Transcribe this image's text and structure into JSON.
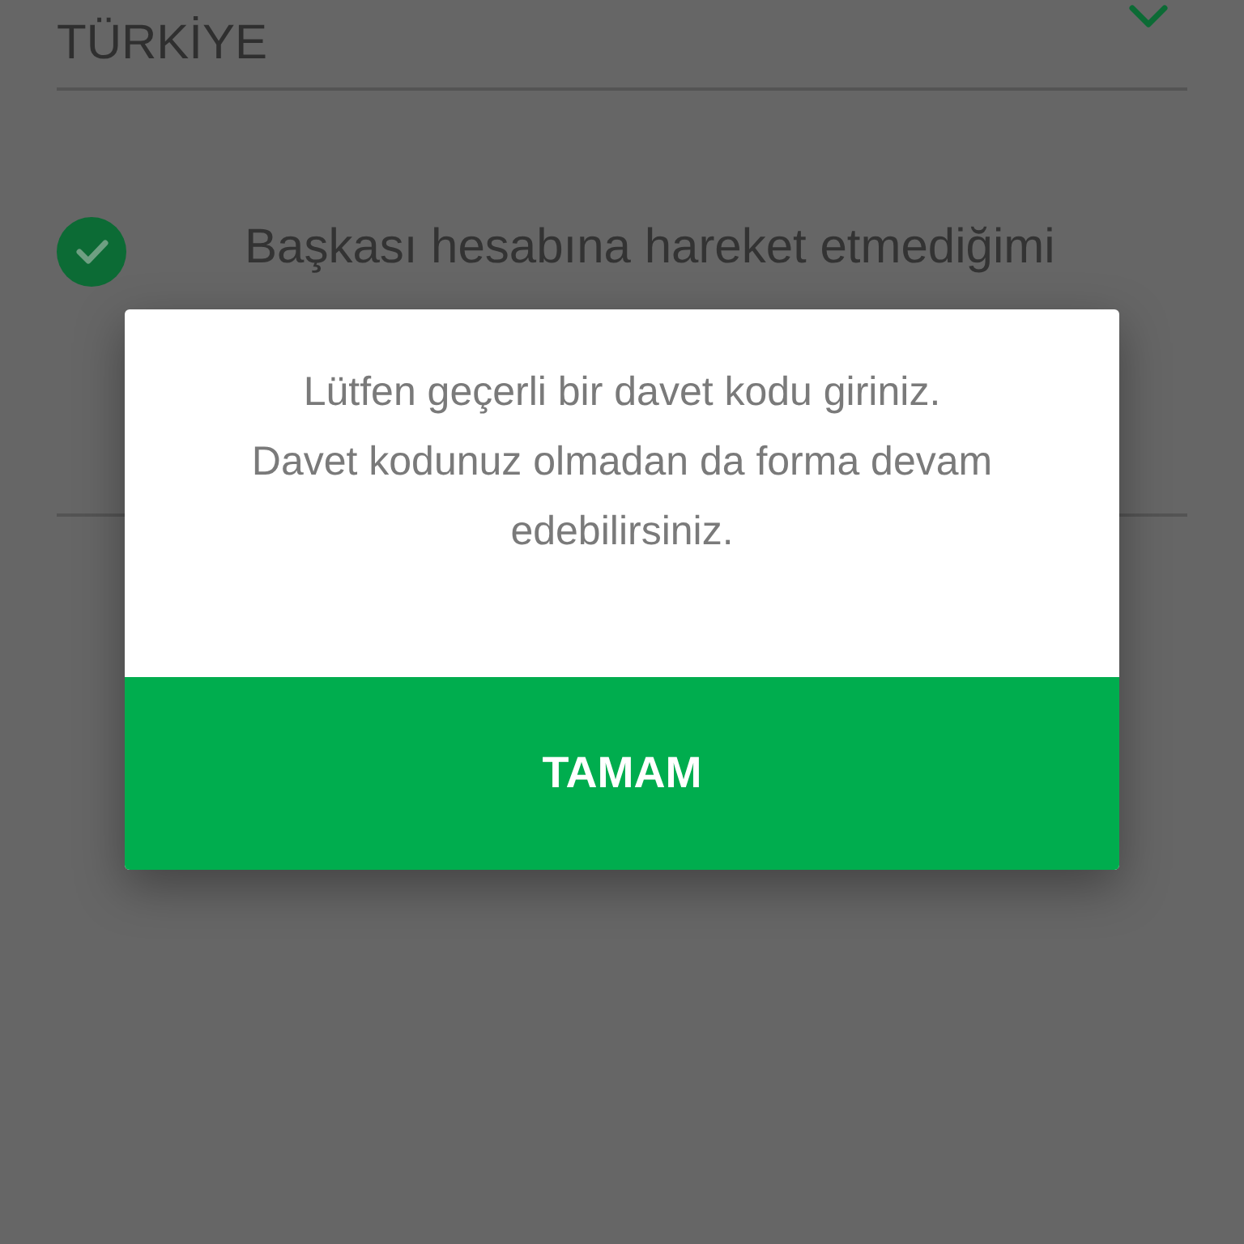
{
  "country_field": {
    "value": "TÜRKİYE"
  },
  "consent": {
    "checked": true,
    "text": "Başkası hesabına hareket etmediğimi"
  },
  "dialog": {
    "message": "Lütfen geçerli bir davet kodu giriniz.\nDavet kodunuz olmadan da forma devam edebilirsiniz.",
    "button": "TAMAM"
  }
}
